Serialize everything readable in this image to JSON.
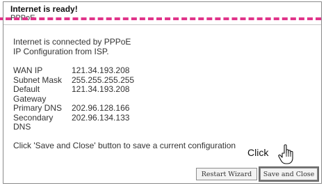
{
  "dialog": {
    "title": "Internet is ready!",
    "subtitle": "PPPoE"
  },
  "content": {
    "intro_line1": "Internet is connected by PPPoE",
    "intro_line2": "IP Configuration from ISP.",
    "rows": [
      {
        "label": "WAN IP",
        "value": "121.34.193.208"
      },
      {
        "label": "Subnet Mask",
        "value": "255.255.255.255"
      },
      {
        "label": "Default Gateway",
        "value": "121.34.193.208"
      },
      {
        "label": "Primary DNS",
        "value": "202.96.128.166"
      },
      {
        "label": "Secondary DNS",
        "value": "202.96.134.133"
      }
    ],
    "note": "Click 'Save and Close' button to save a current configuration"
  },
  "buttons": {
    "restart_label": "Restart Wizard",
    "save_label": "Save and Close"
  },
  "annotation": {
    "click_label": "Click",
    "dash_color": "#e0348a"
  }
}
